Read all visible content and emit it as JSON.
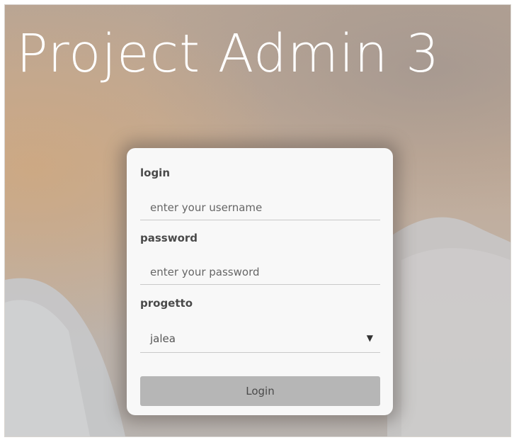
{
  "page": {
    "title": "Project Admin 3"
  },
  "form": {
    "login": {
      "label": "login",
      "placeholder": "enter your username"
    },
    "password": {
      "label": "password",
      "placeholder": "enter your password"
    },
    "progetto": {
      "label": "progetto",
      "selected": "jalea"
    },
    "submit_label": "Login"
  },
  "icons": {
    "dropdown": "caret-down-icon"
  },
  "colors": {
    "title_text": "#ffffff",
    "card_bg": "#f8f8f8",
    "button_bg": "#b6b6b6"
  }
}
